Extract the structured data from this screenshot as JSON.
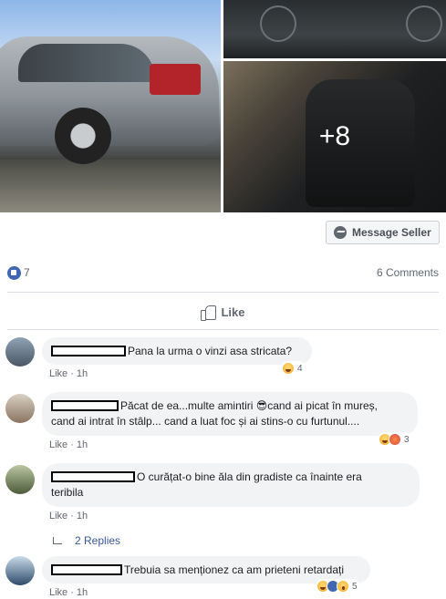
{
  "photos": {
    "more_count": "+8"
  },
  "seller_button": {
    "label": "Message Seller",
    "icon": "messenger-icon"
  },
  "stats": {
    "likes": "7",
    "comments": "6 Comments"
  },
  "actions": {
    "like_label": "Like"
  },
  "comments": [
    {
      "text": "Pana la urma o vinzi asa stricata?",
      "like_label": "Like",
      "time": "1h",
      "reaction_count": "4"
    },
    {
      "text_line1": "Păcat de ea...multe amintiri 😎cand ai picat în mureș,",
      "text_line2": "cand ai intrat în stâlp... cand a luat foc și ai stins-o cu furtunul....",
      "like_label": "Like",
      "time": "1h",
      "reaction_count": "3"
    },
    {
      "text_line1": "O curățat-o bine ăla din gradiste ca înainte era",
      "text_line2": "teribila",
      "like_label": "Like",
      "time": "1h",
      "replies_label": "2 Replies"
    },
    {
      "text": "Trebuia sa menționez ca am prieteni retardați",
      "like_label": "Like",
      "time": "1h",
      "reaction_count": "5"
    }
  ]
}
